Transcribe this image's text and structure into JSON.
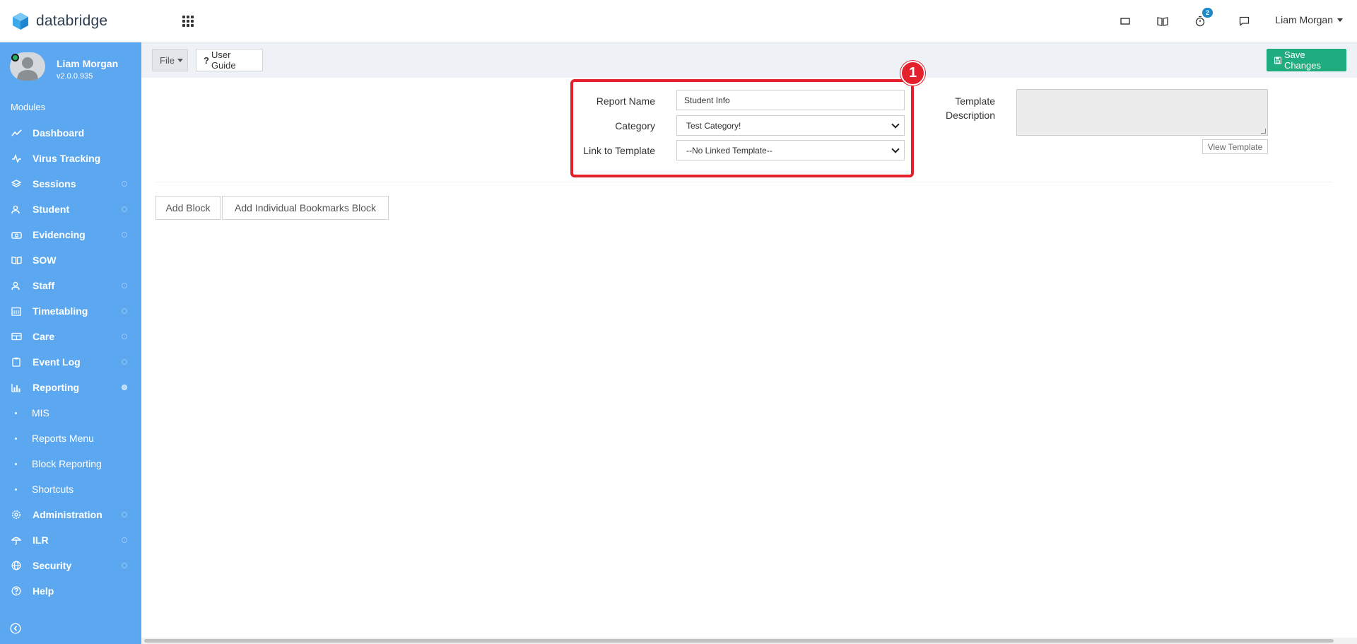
{
  "app": {
    "brand_name": "databridge",
    "accent": "#5ca8f0"
  },
  "topbar": {
    "icons": [
      "window-icon",
      "book-icon",
      "timer-icon",
      "chat-icon"
    ],
    "notification_count": "2",
    "user_name": "Liam Morgan"
  },
  "sidebar": {
    "user_name": "Liam Morgan",
    "version": "v2.0.0.935",
    "modules_label": "Modules",
    "items": [
      {
        "label": "Dashboard",
        "icon": "chart-line-icon"
      },
      {
        "label": "Virus Tracking",
        "icon": "pulse-icon"
      },
      {
        "label": "Sessions",
        "icon": "layers-icon"
      },
      {
        "label": "Student",
        "icon": "users-icon"
      },
      {
        "label": "Evidencing",
        "icon": "camera-icon"
      },
      {
        "label": "SOW",
        "icon": "book-icon"
      },
      {
        "label": "Staff",
        "icon": "users-icon"
      },
      {
        "label": "Timetabling",
        "icon": "calendar-icon"
      },
      {
        "label": "Care",
        "icon": "id-card-icon"
      },
      {
        "label": "Event Log",
        "icon": "clipboard-icon"
      },
      {
        "label": "Reporting",
        "icon": "bar-chart-icon"
      }
    ],
    "sub_items": [
      {
        "label": "MIS"
      },
      {
        "label": "Reports Menu"
      },
      {
        "label": "Block Reporting"
      },
      {
        "label": "Shortcuts"
      }
    ],
    "items_bottom": [
      {
        "label": "Administration",
        "icon": "gear-icon"
      },
      {
        "label": "ILR",
        "icon": "umbrella-icon"
      },
      {
        "label": "Security",
        "icon": "globe-icon"
      },
      {
        "label": "Help",
        "icon": "help-icon"
      }
    ]
  },
  "toolbar": {
    "file_label": "File",
    "guide_label": "User Guide",
    "save_label": "Save Changes",
    "save_color": "#1fac7e"
  },
  "form": {
    "step_number": "1",
    "report_name_label": "Report Name",
    "report_name_value": "Student Info",
    "category_label": "Category",
    "category_value": "Test Category!",
    "link_label": "Link to Template",
    "link_value": "--No Linked Template--",
    "template_label_line1": "Template",
    "template_label_line2": "Description",
    "template_description": "",
    "view_template_label": "View Template",
    "highlight_color": "#e3202b"
  },
  "blocks": {
    "add_block_label": "Add Block",
    "add_bookmarks_label": "Add Individual Bookmarks Block"
  }
}
